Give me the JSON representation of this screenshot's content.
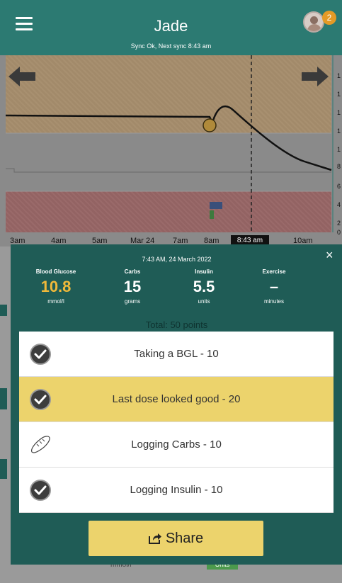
{
  "header": {
    "title": "Jade",
    "sync_status": "Sync Ok, Next sync 8:43 am",
    "notification_count": "2"
  },
  "chart": {
    "y_ticks": [
      "1",
      "1",
      "1",
      "1",
      "1",
      "8",
      "6",
      "4",
      "2",
      "0"
    ],
    "x_ticks": [
      "3am",
      "4am",
      "5am",
      "Mar 24",
      "7am",
      "8am",
      "10am"
    ],
    "now_label": "8:43 am"
  },
  "background": {
    "unit_text": "mmol/l",
    "badge_text": "Units"
  },
  "summary": {
    "datetime": "7:43 AM, 24 March 2022",
    "metrics": [
      {
        "label": "Blood Glucose",
        "value": "10.8",
        "unit": "mmol/l"
      },
      {
        "label": "Carbs",
        "value": "15",
        "unit": "grams"
      },
      {
        "label": "Insulin",
        "value": "5.5",
        "unit": "units"
      },
      {
        "label": "Exercise",
        "value": "–",
        "unit": "minutes"
      }
    ],
    "total": "Total: 50 points",
    "items": [
      {
        "label": "Taking a BGL - 10",
        "icon": "check-circle-icon"
      },
      {
        "label": "Last dose looked good - 20",
        "icon": "check-circle-icon"
      },
      {
        "label": "Logging Carbs - 10",
        "icon": "bread-icon"
      },
      {
        "label": "Logging Insulin - 10",
        "icon": "check-circle-icon"
      }
    ],
    "share_label": "Share",
    "close_label": "×"
  },
  "colors": {
    "header_teal": "#2c7a72",
    "card_teal": "#1f5c56",
    "highlight_yellow": "#ecd36c",
    "glucose_orange": "#f0b93a"
  }
}
